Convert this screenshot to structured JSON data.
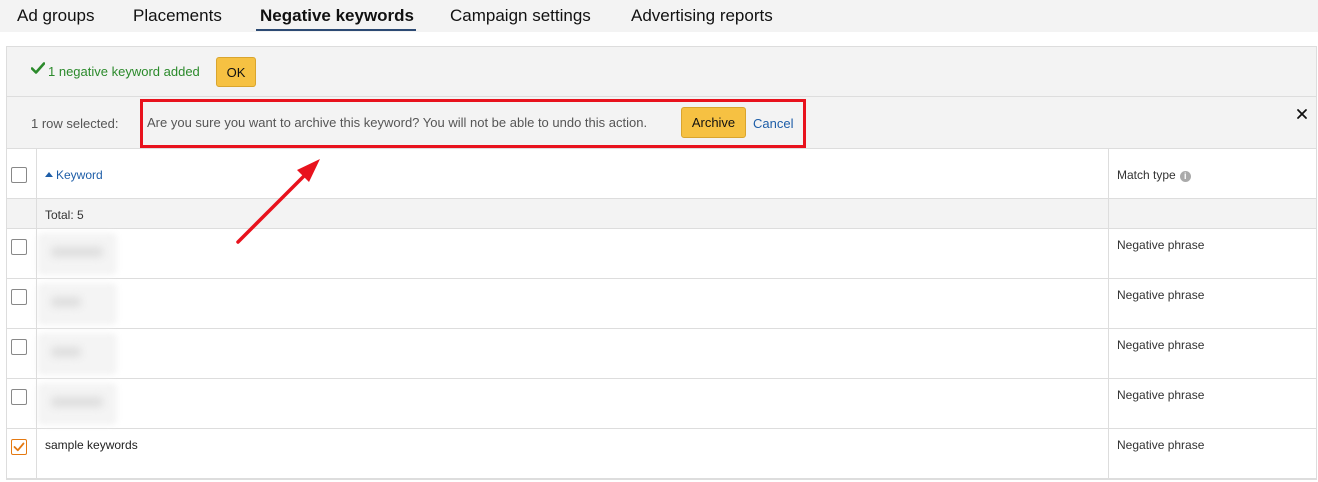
{
  "tabs": [
    {
      "label": "Ad groups"
    },
    {
      "label": "Placements"
    },
    {
      "label": "Negative keywords"
    },
    {
      "label": "Campaign settings"
    },
    {
      "label": "Advertising reports"
    }
  ],
  "notice": {
    "message": "1 negative keyword added",
    "ok_label": "OK"
  },
  "selection_bar": {
    "count_text": "1 row selected:",
    "confirm_text": "Are you sure you want to archive this keyword? You will not be able to undo this action.",
    "archive_label": "Archive",
    "cancel_label": "Cancel"
  },
  "table": {
    "col_keyword": "Keyword",
    "col_match_type": "Match type",
    "total_text": "Total: 5",
    "rows": [
      {
        "keyword": "",
        "match_type": "Negative phrase",
        "checked": false
      },
      {
        "keyword": "",
        "match_type": "Negative phrase",
        "checked": false
      },
      {
        "keyword": "",
        "match_type": "Negative phrase",
        "checked": false
      },
      {
        "keyword": "",
        "match_type": "Negative phrase",
        "checked": false
      },
      {
        "keyword": "sample keywords",
        "match_type": "Negative phrase",
        "checked": true
      }
    ]
  },
  "colors": {
    "accent_button": "#f6c142",
    "link": "#1e5ea8",
    "success": "#2b8a2b",
    "annotation": "#e8121d"
  }
}
